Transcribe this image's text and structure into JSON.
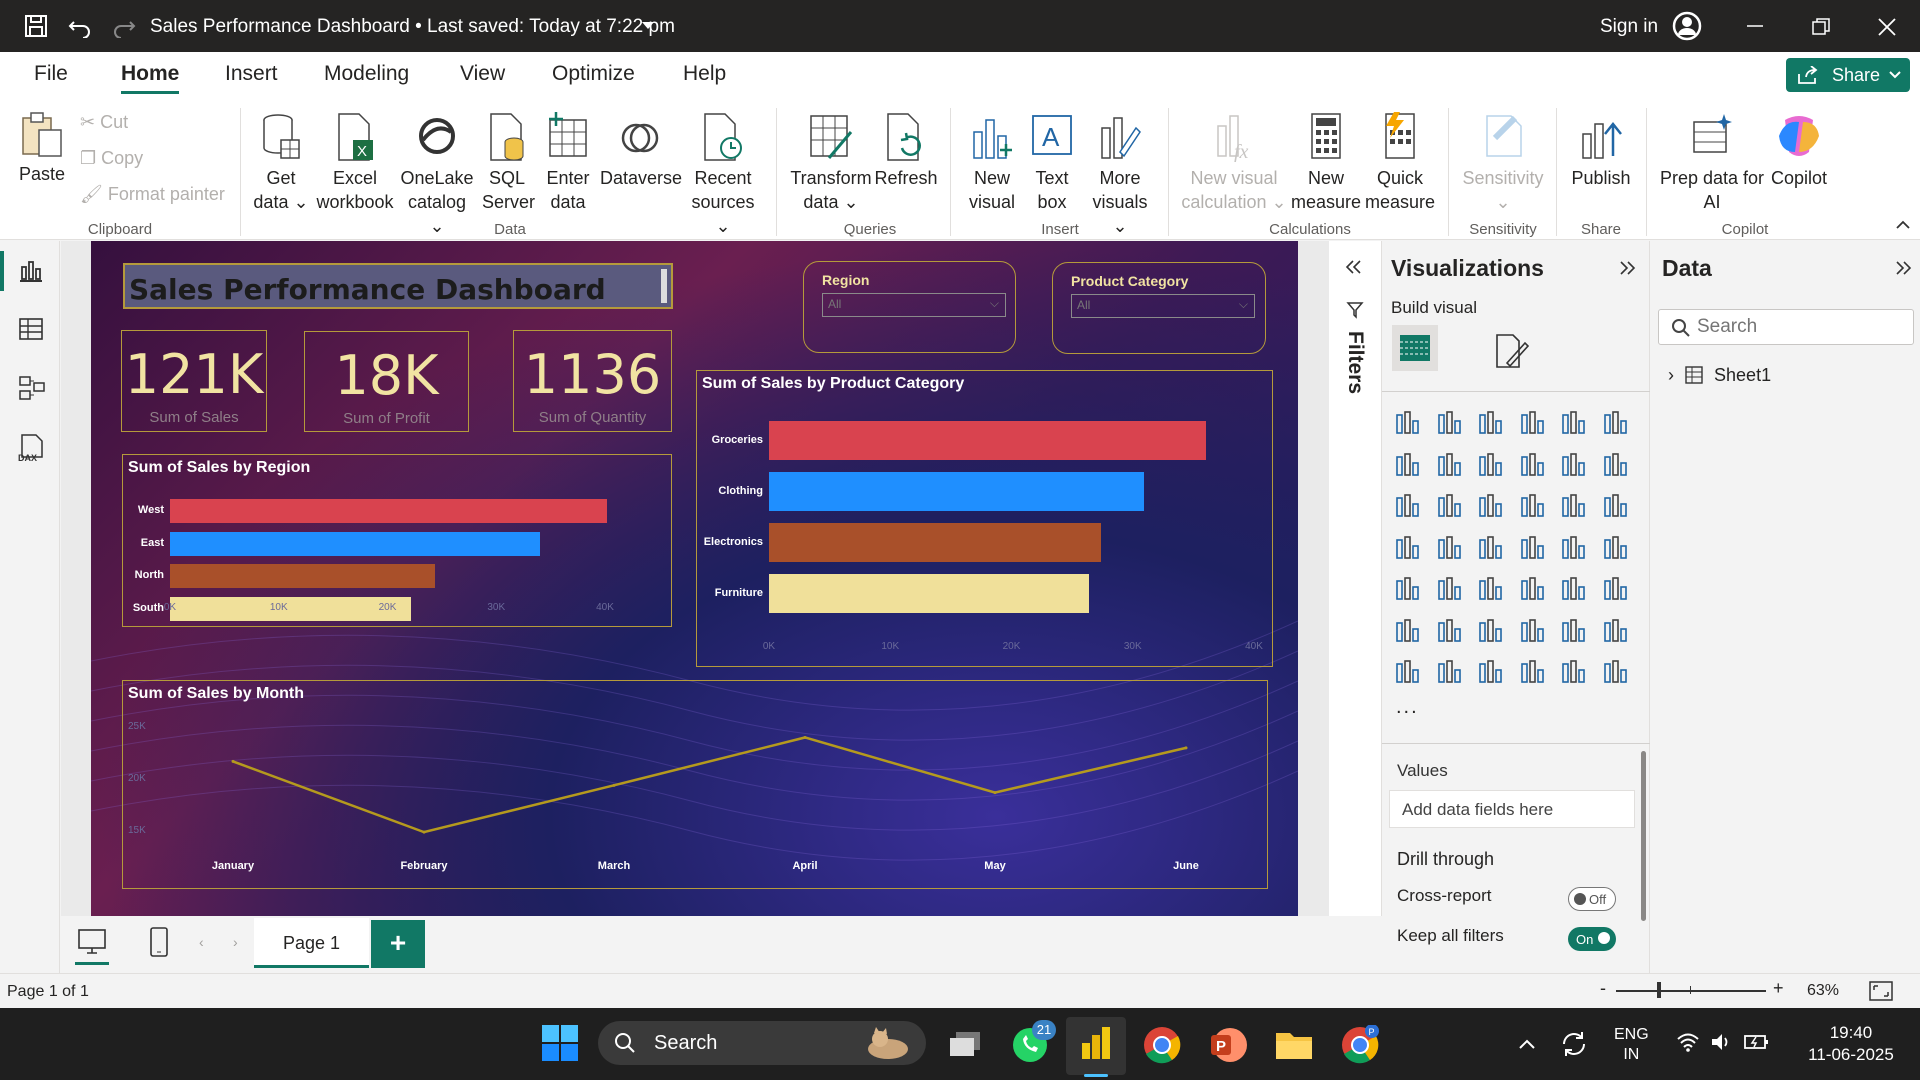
{
  "titlebar": {
    "doc_title": "Sales Performance Dashboard",
    "saved": "Last saved: Today at 7:22 pm",
    "sign_in": "Sign in"
  },
  "menu": {
    "file": "File",
    "home": "Home",
    "insert": "Insert",
    "modeling": "Modeling",
    "view": "View",
    "optimize": "Optimize",
    "help": "Help",
    "share": "Share"
  },
  "ribbon": {
    "paste": "Paste",
    "cut": "Cut",
    "copy": "Copy",
    "format_painter": "Format painter",
    "clipboard": "Clipboard",
    "get_data_1": "Get",
    "get_data_2": "data",
    "excel_1": "Excel",
    "excel_2": "workbook",
    "onelake_1": "OneLake",
    "onelake_2": "catalog",
    "sql_1": "SQL",
    "sql_2": "Server",
    "enter_1": "Enter",
    "enter_2": "data",
    "dataverse": "Dataverse",
    "recent_1": "Recent",
    "recent_2": "sources",
    "data_group": "Data",
    "transform_1": "Transform",
    "transform_2": "data",
    "refresh": "Refresh",
    "queries": "Queries",
    "new_visual_1": "New",
    "new_visual_2": "visual",
    "text_box_1": "Text",
    "text_box_2": "box",
    "more_visuals_1": "More",
    "more_visuals_2": "visuals",
    "insert_group": "Insert",
    "new_visual_calc_1": "New visual",
    "new_visual_calc_2": "calculation",
    "new_measure_1": "New",
    "new_measure_2": "measure",
    "quick_measure_1": "Quick",
    "quick_measure_2": "measure",
    "calculations": "Calculations",
    "sensitivity": "Sensitivity",
    "sensitivity_group": "Sensitivity",
    "publish": "Publish",
    "share_group": "Share",
    "prep_data_1": "Prep data for",
    "prep_data_2": "AI",
    "copilot": "Copilot",
    "copilot_group": "Copilot"
  },
  "report": {
    "title": "Sales Performance Dashboard",
    "kpis": [
      {
        "value": "121K",
        "label": "Sum of Sales"
      },
      {
        "value": "18K",
        "label": "Sum of Profit"
      },
      {
        "value": "1136",
        "label": "Sum of Quantity"
      }
    ],
    "slicers": [
      {
        "title": "Region",
        "value": "All"
      },
      {
        "title": "Product Category",
        "value": "All"
      }
    ],
    "colors": {
      "red": "#d9434f",
      "blue": "#1f8fff",
      "brown": "#a9502a",
      "yellow": "#f0e09a",
      "line": "#b59a1e",
      "border": "#b59a3b"
    }
  },
  "chart_data": [
    {
      "type": "bar",
      "title": "Sum of Sales by Region",
      "categories": [
        "West",
        "East",
        "North",
        "South"
      ],
      "values": [
        40200,
        34000,
        24400,
        22200
      ],
      "xticks": [
        "0K",
        "10K",
        "20K",
        "30K",
        "40K"
      ],
      "xlim": [
        0,
        40000
      ]
    },
    {
      "type": "bar",
      "title": "Sum of Sales by Product Category",
      "categories": [
        "Groceries",
        "Clothing",
        "Electronics",
        "Furniture"
      ],
      "values": [
        36000,
        30900,
        27400,
        26400
      ],
      "xticks": [
        "0K",
        "10K",
        "20K",
        "30K",
        "40K"
      ],
      "xlim": [
        0,
        40000
      ]
    },
    {
      "type": "line",
      "title": "Sum of Sales by Month",
      "x": [
        "January",
        "February",
        "March",
        "April",
        "May",
        "June"
      ],
      "values": [
        21500,
        14700,
        19200,
        23800,
        18500,
        22800
      ],
      "yticks": [
        "15K",
        "20K",
        "25K"
      ],
      "ylim": [
        15000,
        25000
      ]
    }
  ],
  "filters": {
    "label": "Filters"
  },
  "viz": {
    "title": "Visualizations",
    "build": "Build visual",
    "values": "Values",
    "add_fields": "Add data fields here",
    "drill": "Drill through",
    "cross_report": "Cross-report",
    "cross_state": "Off",
    "keep_filters": "Keep all filters",
    "keep_state": "On",
    "more": "..."
  },
  "data": {
    "title": "Data",
    "search_placeholder": "Search",
    "table": "Sheet1"
  },
  "pages": {
    "page1": "Page 1"
  },
  "status": {
    "page_of": "Page 1 of 1",
    "zoom": "63%"
  },
  "taskbar": {
    "search": "Search",
    "badge": "21",
    "lang1": "ENG",
    "lang2": "IN",
    "time": "19:40",
    "date": "11-06-2025"
  }
}
